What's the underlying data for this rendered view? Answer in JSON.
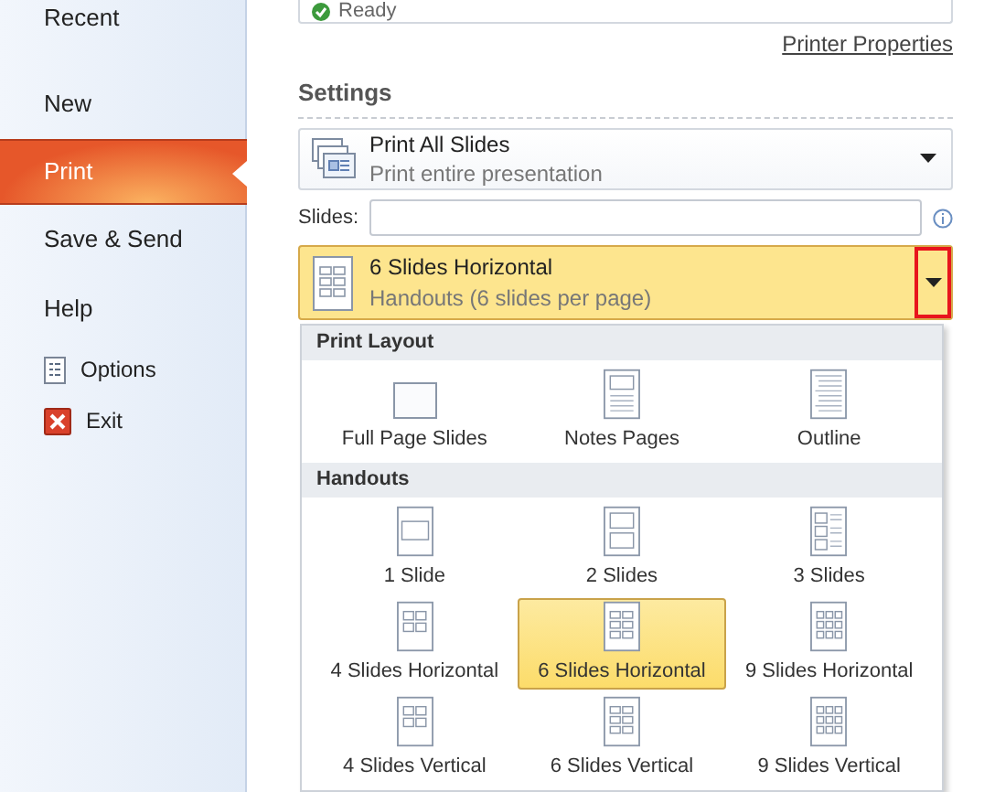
{
  "sidebar": {
    "items": [
      {
        "label": "Recent",
        "kind": "page",
        "selected": false
      },
      {
        "label": "New",
        "kind": "page",
        "selected": false
      },
      {
        "label": "Print",
        "kind": "page",
        "selected": true
      },
      {
        "label": "Save & Send",
        "kind": "page",
        "selected": false
      },
      {
        "label": "Help",
        "kind": "page",
        "selected": false
      },
      {
        "label": "Options",
        "kind": "options",
        "selected": false
      },
      {
        "label": "Exit",
        "kind": "exit",
        "selected": false
      }
    ]
  },
  "printer": {
    "status": "Ready",
    "properties_link": "Printer Properties"
  },
  "settings": {
    "title": "Settings",
    "print_range": {
      "title": "Print All Slides",
      "subtitle": "Print entire presentation"
    },
    "slides_label": "Slides:",
    "layout": {
      "title": "6 Slides Horizontal",
      "subtitle": "Handouts (6 slides per page)",
      "expanded": true
    }
  },
  "gallery": {
    "sections": [
      {
        "title": "Print Layout",
        "items": [
          {
            "label": "Full Page Slides",
            "kind": "full",
            "selected": false
          },
          {
            "label": "Notes Pages",
            "kind": "notes",
            "selected": false
          },
          {
            "label": "Outline",
            "kind": "outline",
            "selected": false
          }
        ]
      },
      {
        "title": "Handouts",
        "items": [
          {
            "label": "1 Slide",
            "kind": "s1",
            "selected": false
          },
          {
            "label": "2 Slides",
            "kind": "s2",
            "selected": false
          },
          {
            "label": "3 Slides",
            "kind": "s3",
            "selected": false
          },
          {
            "label": "4 Slides Horizontal",
            "kind": "s4",
            "selected": false
          },
          {
            "label": "6 Slides Horizontal",
            "kind": "s6",
            "selected": true
          },
          {
            "label": "9 Slides Horizontal",
            "kind": "s9",
            "selected": false
          },
          {
            "label": "4 Slides Vertical",
            "kind": "s4",
            "selected": false
          },
          {
            "label": "6 Slides Vertical",
            "kind": "s6",
            "selected": false
          },
          {
            "label": "9 Slides Vertical",
            "kind": "s9",
            "selected": false
          }
        ]
      }
    ]
  }
}
